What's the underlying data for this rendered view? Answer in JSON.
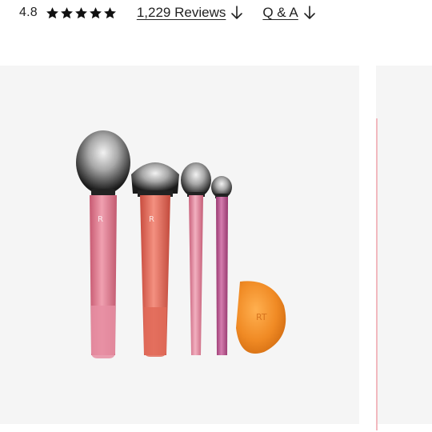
{
  "rating": {
    "value": "4.8",
    "stars": 5,
    "star_color": "#111111"
  },
  "reviews_link": {
    "label": "1,229 Reviews",
    "icon": "arrow-down-icon"
  },
  "qa_link": {
    "label": "Q & A",
    "icon": "arrow-down-icon"
  },
  "gallery": {
    "background": "#f5f5f5",
    "image": "product-image",
    "colors": {
      "pink_handle": "#e07a8e",
      "coral_handle": "#e0705e",
      "purple_handle": "#b8508a",
      "sponge": "#f08a24"
    }
  }
}
